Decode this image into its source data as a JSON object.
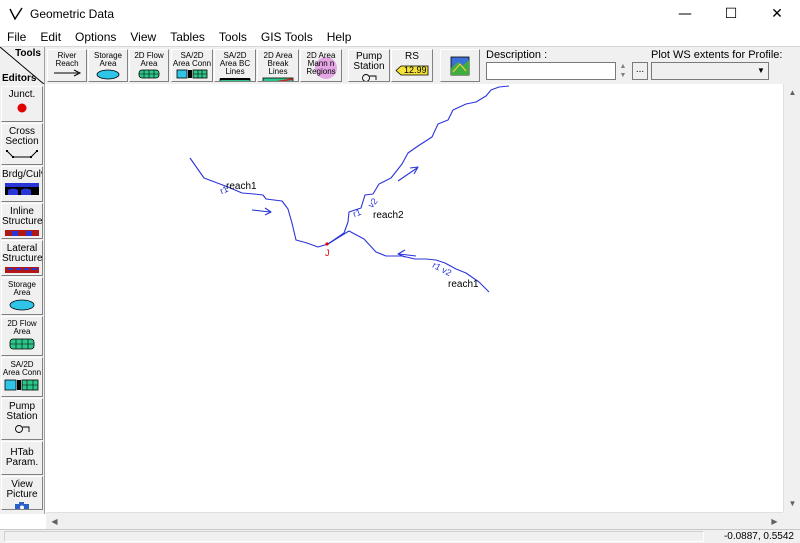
{
  "window": {
    "title": "Geometric Data",
    "minimize_glyph": "—",
    "maximize_glyph": "☐",
    "close_glyph": "✕"
  },
  "menu": [
    "File",
    "Edit",
    "Options",
    "View",
    "Tables",
    "Tools",
    "GIS Tools",
    "Help"
  ],
  "toolbar": {
    "tools_label": "Tools",
    "editors_label": "Editors",
    "buttons": [
      {
        "label": "River Reach",
        "icon": "arrow-right-icon"
      },
      {
        "label": "Storage Area",
        "icon": "storage-area-icon"
      },
      {
        "label": "2D Flow Area",
        "icon": "grid-icon"
      },
      {
        "label": "SA/2D Area Conn",
        "icon": "connection-icon"
      },
      {
        "label": "SA/2D Area BC Lines",
        "icon": "bc-lines-icon"
      },
      {
        "label": "2D Area Break Lines",
        "icon": "break-lines-icon"
      },
      {
        "label": "2D Area Mann n Regions",
        "icon": "mann-regions-icon"
      },
      {
        "label": "Pump Station",
        "icon": "pump-icon"
      },
      {
        "label": "RS",
        "value": "12.99",
        "icon": "river-station-icon"
      },
      {
        "label": "",
        "icon": "gis-map-icon"
      }
    ],
    "description_label": "Description :",
    "description_value": "",
    "more_button": "...",
    "profile_label": "Plot WS extents for Profile:",
    "profile_value": ""
  },
  "editors": [
    {
      "label": "Junct.",
      "icon": "junction-icon"
    },
    {
      "label": "Cross Section",
      "icon": "cross-section-icon"
    },
    {
      "label": "Brdg/Culv",
      "icon": "bridge-icon"
    },
    {
      "label": "Inline Structure",
      "icon": "inline-structure-icon"
    },
    {
      "label": "Lateral Structure",
      "icon": "lateral-structure-icon"
    },
    {
      "label": "Storage Area",
      "icon": "storage-area-icon"
    },
    {
      "label": "2D Flow Area",
      "icon": "grid-icon"
    },
    {
      "label": "SA/2D Area Conn",
      "icon": "connection-icon"
    },
    {
      "label": "Pump Station",
      "icon": "pump-icon"
    },
    {
      "label": "HTab Param.",
      "icon": ""
    },
    {
      "label": "View Picture",
      "icon": "camera-icon"
    }
  ],
  "canvas": {
    "reach_labels": [
      {
        "text": "reach1"
      },
      {
        "text": "reach2"
      },
      {
        "text": "reach1"
      }
    ],
    "river_labels": [
      {
        "text": "r1"
      },
      {
        "text": "r1"
      },
      {
        "text": "v2"
      },
      {
        "text": "r1 v2"
      }
    ],
    "junction_label": "J",
    "colors": {
      "river": "#2a35d8",
      "junction": "#e00000"
    }
  },
  "status": {
    "coords": "-0.0887, 0.5542"
  }
}
